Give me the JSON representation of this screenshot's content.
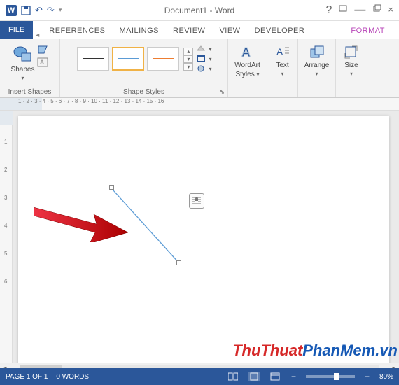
{
  "title": "Document1 - Word",
  "qat": {
    "undo": "↶",
    "redo": "↷"
  },
  "tabs": {
    "file": "FILE",
    "items": [
      "REFERENCES",
      "MAILINGS",
      "REVIEW",
      "VIEW",
      "DEVELOPER"
    ],
    "context": "FORMAT"
  },
  "ribbon": {
    "insert_shapes": {
      "shapes_label": "Shapes",
      "group_label": "Insert Shapes"
    },
    "shape_styles": {
      "group_label": "Shape Styles",
      "fill_label": "Shape Fill",
      "outline_label": "Shape Outline",
      "effects_label": "Shape Effects"
    },
    "wordart": {
      "label": "WordArt",
      "sub": "Styles"
    },
    "text": {
      "label": "Text"
    },
    "arrange": {
      "label": "Arrange"
    },
    "size": {
      "label": "Size"
    }
  },
  "ruler_h": "1 · 2 · 3 · 4 · 5 · 6 · 7 · 8 · 9 · 10 · 11 · 12 · 13 · 14 · 15 · 16",
  "ruler_v": [
    "1",
    "2",
    "3",
    "4",
    "5",
    "6"
  ],
  "status": {
    "page": "PAGE 1 OF 1",
    "words": "0 WORDS",
    "zoom": "80%"
  },
  "watermark": {
    "a": "ThuThuat",
    "b": "PhanMem",
    "c": ".vn"
  },
  "colors": {
    "accent": "#2b579a",
    "context": "#b846b8",
    "arrow": "#c21b17"
  }
}
